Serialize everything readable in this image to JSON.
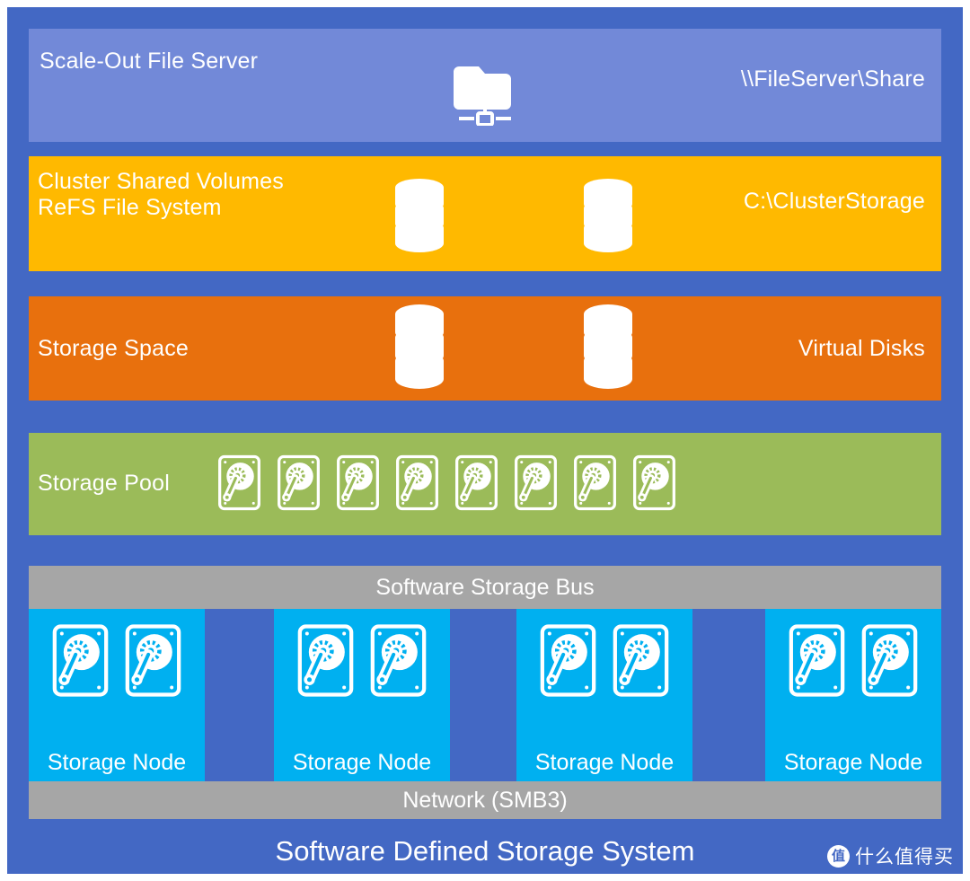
{
  "diagram": {
    "footer_title": "Software Defined Storage System",
    "background_color": "#4368c4"
  },
  "layers": {
    "file_server": {
      "label": "Scale-Out File Server",
      "path": "\\\\FileServer\\Share",
      "color": "#7289d8",
      "icon": "shared-folder-icon"
    },
    "cluster_shared_volumes": {
      "label": "Cluster Shared Volumes\nReFS File System",
      "path": "C:\\ClusterStorage",
      "color": "#ffb900",
      "volume_count": 2,
      "icon": "disk-stack-icon"
    },
    "storage_space": {
      "label": "Storage Space",
      "right_label": "Virtual Disks",
      "color": "#e8700d",
      "volume_count": 2,
      "icon": "disk-stack-icon"
    },
    "storage_pool": {
      "label": "Storage Pool",
      "color": "#9bbb59",
      "disk_count": 8,
      "icon": "hard-disk-icon"
    },
    "software_storage_bus": {
      "label": "Software Storage Bus",
      "color": "#a6a6a6"
    },
    "network": {
      "label": "Network (SMB3)",
      "color": "#a6a6a6"
    }
  },
  "nodes": {
    "color": "#00b0f0",
    "disks_per_node": 2,
    "items": [
      {
        "label": "Storage Node"
      },
      {
        "label": "Storage Node"
      },
      {
        "label": "Storage Node"
      },
      {
        "label": "Storage Node"
      }
    ]
  },
  "watermark": {
    "logo_glyph": "值",
    "text": "什么值得买"
  }
}
